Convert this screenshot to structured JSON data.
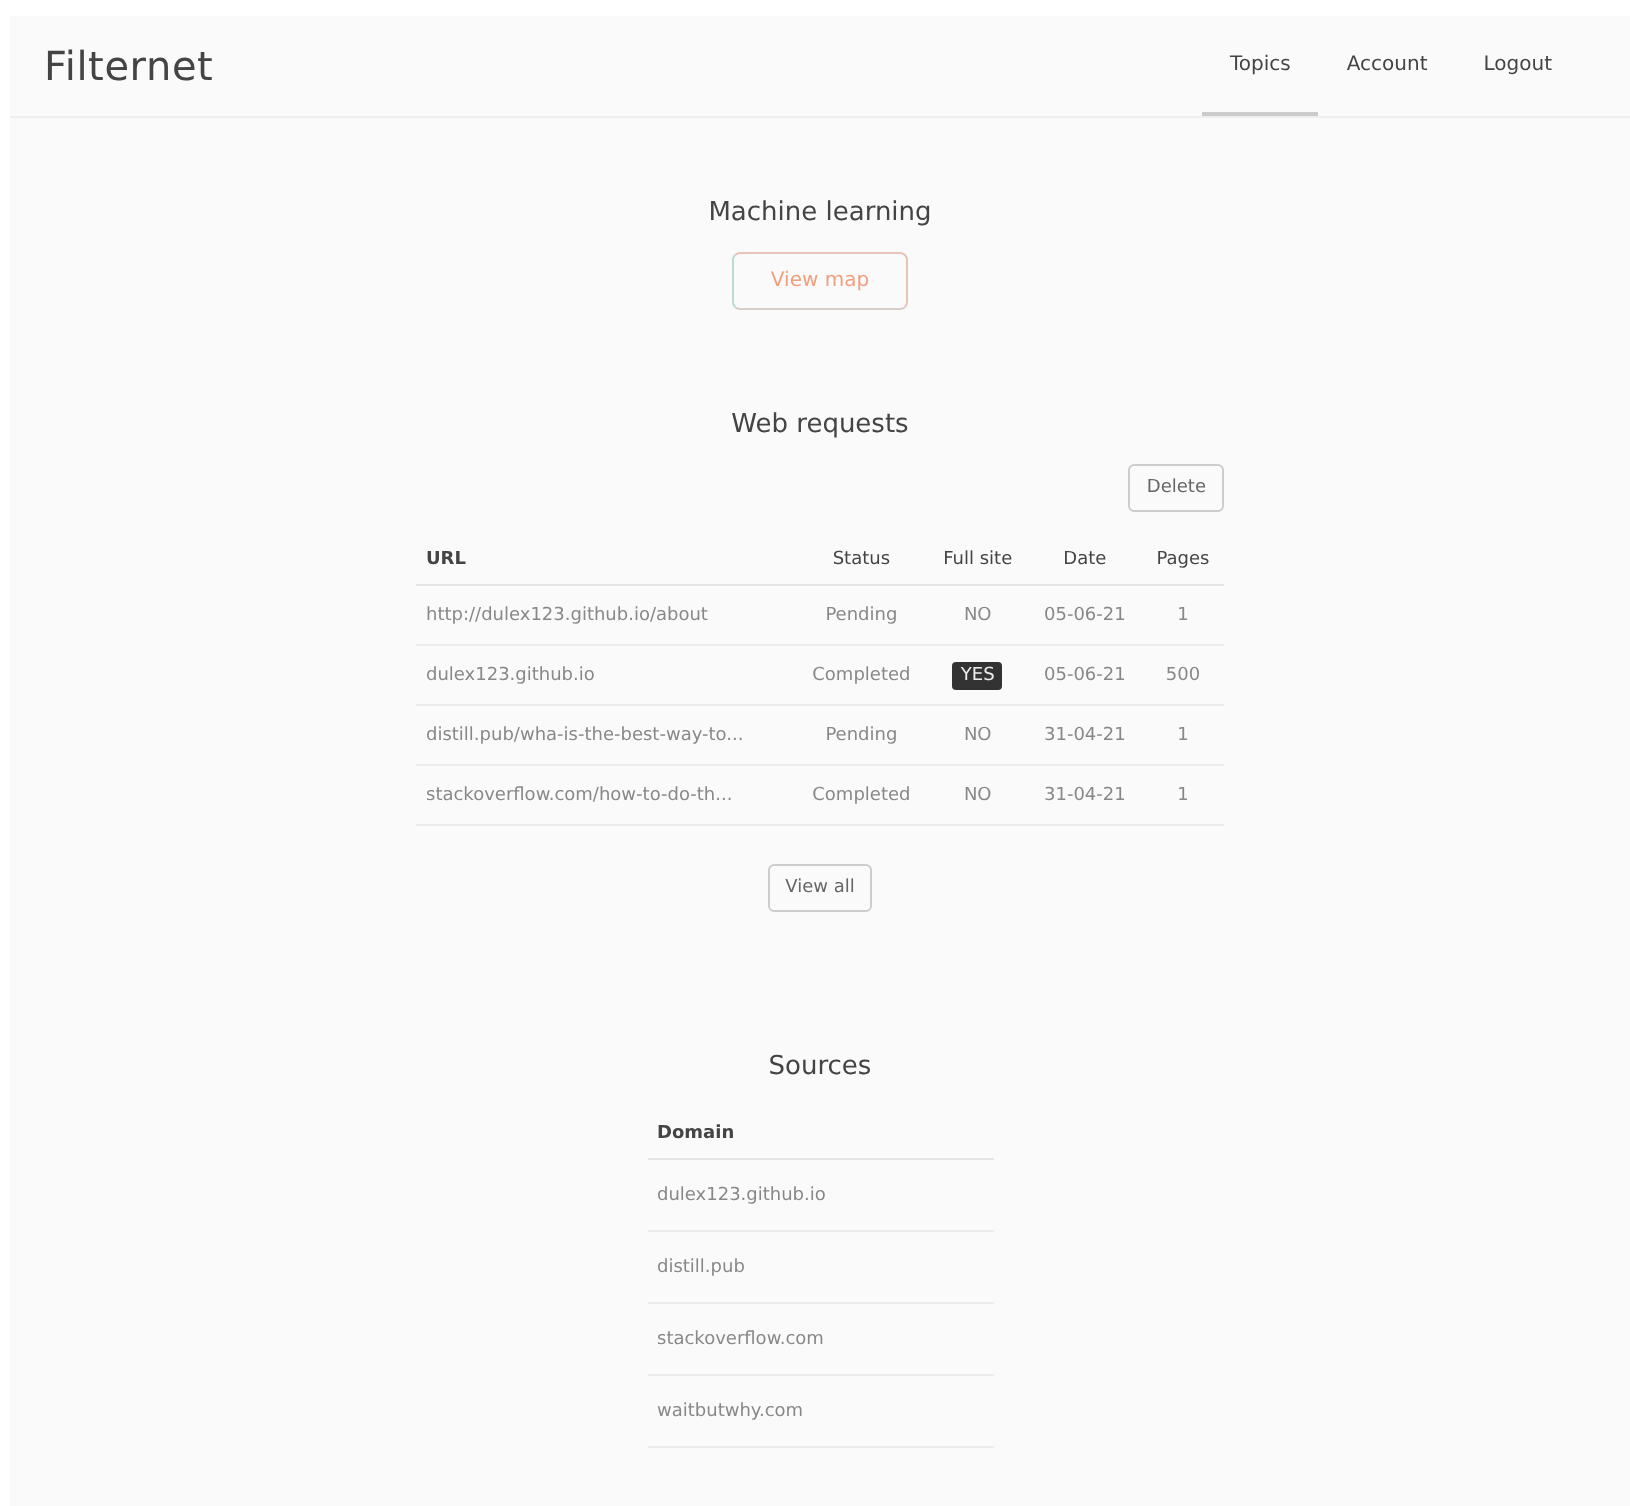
{
  "brand": "Filternet",
  "nav": [
    {
      "label": "Topics",
      "selected": true
    },
    {
      "label": "Account",
      "selected": false
    },
    {
      "label": "Logout",
      "selected": false
    }
  ],
  "topic": {
    "title": "Machine learning",
    "button": "View map"
  },
  "web_requests": {
    "title": "Web requests",
    "delete_button": "Delete",
    "columns": [
      "URL",
      "Status",
      "Full site",
      "Date",
      "Pages"
    ],
    "rows": [
      {
        "url": "http://dulex123.github.io/about",
        "status": "Pending",
        "full_site": {
          "text": "NO",
          "highlighted": false
        },
        "date": "05-06-21",
        "pages": "1"
      },
      {
        "url": "dulex123.github.io",
        "status": "Completed",
        "full_site": {
          "text": "YES",
          "highlighted": true
        },
        "date": "05-06-21",
        "pages": "500"
      },
      {
        "url": "distill.pub/wha-is-the-best-way-to...",
        "status": "Pending",
        "full_site": {
          "text": "NO",
          "highlighted": false
        },
        "date": "31-04-21",
        "pages": "1"
      },
      {
        "url": "stackoverflow.com/how-to-do-th...",
        "status": "Completed",
        "full_site": {
          "text": "NO",
          "highlighted": false
        },
        "date": "31-04-21",
        "pages": "1"
      }
    ],
    "view_all_button": "View all"
  },
  "sources": {
    "title": "Sources",
    "column": "Domain",
    "rows": [
      "dulex123.github.io",
      "distill.pub",
      "stackoverflow.com",
      "waitbutwhy.com"
    ]
  }
}
